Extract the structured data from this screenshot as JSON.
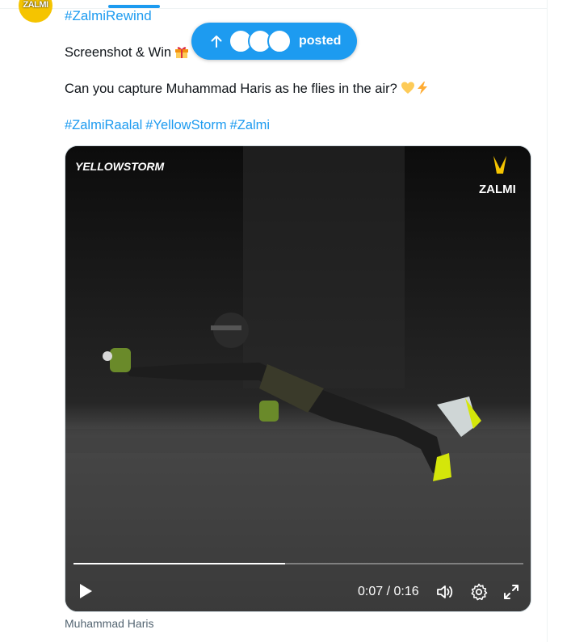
{
  "post": {
    "author_avatar_text": "ZALMI",
    "top_hashtag": "#ZalmiRewind",
    "line1": "Screenshot & Win",
    "line2": "Can you capture Muhammad Haris as he flies in the air?",
    "hashtags": [
      "#ZalmiRaalal",
      "#YellowStorm",
      "#Zalmi"
    ],
    "media_caption": "Muhammad Haris"
  },
  "posted_pill": {
    "label": "posted"
  },
  "video": {
    "watermark_left": "YELLOWSTORM",
    "watermark_right": "ZALMI",
    "current_time": "0:07",
    "duration": "0:16",
    "time_display": "0:07 / 0:16",
    "progress": 0.47
  },
  "colors": {
    "accent": "#1d9bf0",
    "text": "#0f1419",
    "muted": "#536471",
    "brand_yellow": "#f5c400"
  }
}
